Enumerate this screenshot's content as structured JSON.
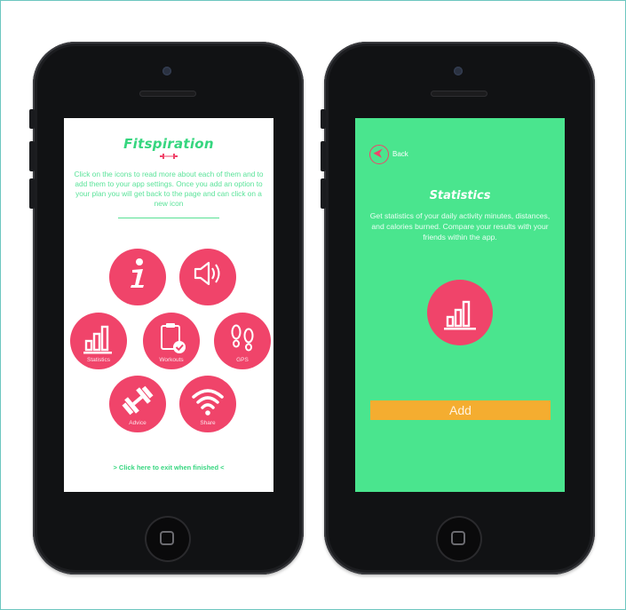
{
  "left_screen": {
    "app_title": "Fitspiration",
    "intro": "Click on the icons to read more about each of them and to add them to your app settings. Once you add an option to your plan you will get back to the page and can click on a new icon",
    "icons": [
      {
        "label": "",
        "icon": "info-icon"
      },
      {
        "label": "",
        "icon": "speaker-icon"
      },
      {
        "label": "Statistics",
        "icon": "bar-chart-icon"
      },
      {
        "label": "Workouts",
        "icon": "clipboard-check-icon"
      },
      {
        "label": "GPS",
        "icon": "footprints-icon"
      },
      {
        "label": "Advice",
        "icon": "dumbbell-icon"
      },
      {
        "label": "Share",
        "icon": "wifi-icon"
      }
    ],
    "finish_text": "> Click here to exit when finished <"
  },
  "right_screen": {
    "back_label": "Back",
    "title": "Statistics",
    "description": "Get statistics of your daily activity minutes, distances, and calories burned. Compare your results with your friends within the app.",
    "add_label": "Add"
  },
  "colors": {
    "accent_green": "#4ae58e",
    "accent_pink": "#f0446a",
    "add_orange": "#f4ad30",
    "device": "#111214"
  }
}
